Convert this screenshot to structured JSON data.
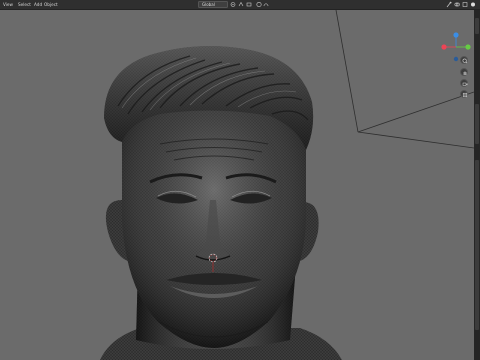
{
  "header": {
    "menus": [
      {
        "label": "View"
      },
      {
        "label": "Select"
      },
      {
        "label": "Add"
      },
      {
        "label": "Object"
      }
    ],
    "transform_orientation": "Global"
  },
  "gizmo": {
    "axes": [
      {
        "axis": "x",
        "color": "#ee4455"
      },
      {
        "axis": "y",
        "color": "#66cc44"
      },
      {
        "axis": "z",
        "color": "#3b8ee6"
      }
    ]
  },
  "nav_buttons": [
    {
      "icon": "zoom-icon"
    },
    {
      "icon": "pan-hand-icon"
    },
    {
      "icon": "camera-icon"
    },
    {
      "icon": "grid-ortho-icon"
    }
  ],
  "model": {
    "description_icon": "sculpt-head-mesh",
    "mesh_color": "#3a3a3a"
  }
}
